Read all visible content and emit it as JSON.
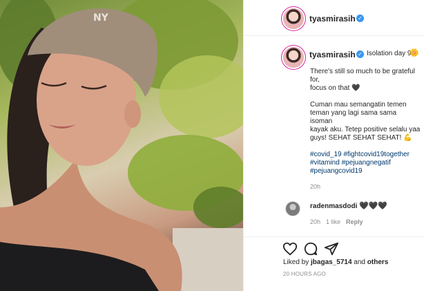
{
  "post": {
    "author": "tyasmirasih",
    "caption_lead": "Isolation day 9",
    "caption_emoji": "🌼",
    "caption_p1_l1": "There's still so much to be grateful",
    "caption_p1_l2": "for,",
    "caption_p1_l3": "focus on that 🖤",
    "caption_p2_l1": "Cuman mau semangatin temen",
    "caption_p2_l2": "teman yang lagi sama sama isoman",
    "caption_p2_l3": "kayak aku. Tetep positive selalu yaa",
    "caption_p2_l4": "guys! SEHAT SEHAT SEHAT! 💪",
    "tags_l1": "#covid_19 #fightcovid19together",
    "tags_l2": "#vitamind #pejuangnegatif",
    "tags_l3": "#pejuangcovid19",
    "caption_time": "20h"
  },
  "comment": {
    "author": "radenmasdodi",
    "text": "🖤🖤🖤",
    "time": "20h",
    "likes": "1 like",
    "reply": "Reply"
  },
  "footer": {
    "liked_prefix": "Liked by ",
    "liked_user": "jbagas_5714",
    "liked_mid": " and ",
    "liked_others": "others",
    "timestamp": "20 HOURS AGO"
  },
  "icons": {
    "like": "heart-icon",
    "comment": "comment-bubble-icon",
    "share": "paper-plane-icon",
    "verified": "verified-badge-icon"
  },
  "colors": {
    "verified": "#3897f0",
    "hashtag": "#00376b",
    "meta": "#8e8e8e"
  }
}
